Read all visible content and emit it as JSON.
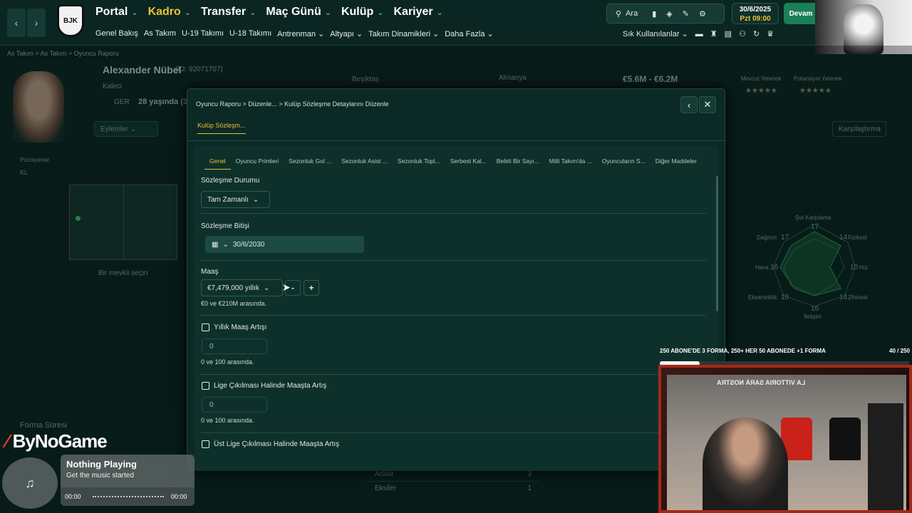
{
  "topbar": {
    "menu": [
      {
        "label": "Portal",
        "active": false
      },
      {
        "label": "Kadro",
        "active": true
      },
      {
        "label": "Transfer",
        "active": false
      },
      {
        "label": "Maç Günü",
        "active": false
      },
      {
        "label": "Kulüp",
        "active": false
      },
      {
        "label": "Kariyer",
        "active": false
      }
    ],
    "submenu": [
      "Genel Bakış",
      "As Takım",
      "U-19 Takımı",
      "U-18 Takımı",
      "Antrenman",
      "Altyapı",
      "Takım Dinamikleri",
      "Daha Fazla"
    ],
    "search_label": "Ara",
    "date": "30/6/2025",
    "day_time": "Pzt  09:00",
    "continue_label": "Devam",
    "quick_label": "Sık Kullanılanlar"
  },
  "background": {
    "breadcrumb": "As Takım  >  As Takım  >  Oyuncu Raporu",
    "player_name": "Alexander Nübel",
    "player_id": "(ID: 92071707)",
    "position": "Kaleci",
    "nation": "GER",
    "age": "28 yaşında (3",
    "club": "Beşiktaş",
    "country": "Almanya",
    "value": "€5.6M - €6.2M",
    "current_ability": "Mevcut Yetenek",
    "potential_ability": "Potansiyel Yetenek",
    "actions": "Eylemler",
    "compare": "Karşılaştırma",
    "positions_label": "Pozisyonlar",
    "positions_value": "KL",
    "choose_position": "Bir mevkii seçin",
    "form_label": "Forma Süresi",
    "list_items": [
      {
        "k": "Artılar",
        "v": "3"
      },
      {
        "k": "Eksiler",
        "v": "1"
      }
    ],
    "radar_labels": {
      "top": "Şut Karşılama",
      "top_val": "17",
      "tl": "Dağıtım",
      "tl_val": "17",
      "tr": "Fiziksel",
      "tr_val": "14",
      "l": "Hava",
      "l_val": "16",
      "r": "Hız",
      "r_val": "10",
      "bl": "Eksantriklik",
      "bl_val": "10",
      "br": "Zihinsel",
      "br_val": "14",
      "bottom": "İletişim",
      "bottom_val": "16"
    }
  },
  "modal": {
    "breadcrumb": "Oyuncu Raporu  >  Düzenle...  >  Kulüp Sözleşme Detaylarını Düzenle",
    "tab": "Kulüp Sözleşm...",
    "inner_tabs": [
      "Genel",
      "Oyuncu Primleri",
      "Sezonluk Gol ...",
      "Sezonluk Asist ...",
      "Sezonluk Topl...",
      "Serbest Kal...",
      "Belirli Bir Sayı...",
      "Milli Takım'da ...",
      "Oyuncuların S...",
      "Diğer Maddeler"
    ],
    "contract_status_label": "Sözleşme Durumu",
    "contract_status_value": "Tam Zamanlı",
    "contract_end_label": "Sözleşme Bitişi",
    "contract_end_value": "30/6/2030",
    "salary_label": "Maaş",
    "salary_value": "€7,479,000 yıllık",
    "salary_hint": "€0 ve €210M arasında.",
    "minus": "-",
    "plus": "+",
    "annual_raise_label": "Yıllık Maaş Artışı",
    "annual_raise_value": "0",
    "annual_raise_hint": "0 ve 100 arasında.",
    "promo_raise_label": "Lige Çıkılması Halinde Maaşta Artış",
    "promo_raise_value": "0",
    "promo_raise_hint": "0 ve 100 arasında.",
    "top_league_label": "Üst Lige Çıkılması Halinde Maaşta Artış"
  },
  "stream": {
    "promo_text": "250 ABONE'DE 3 FORMA, 250+ HER 50 ABONEDE +1 FORMA",
    "promo_count": "40 / 250",
    "progress": 0.16,
    "brand": "ByNoGame",
    "music_title": "Nothing Playing",
    "music_sub": "Get the music started",
    "time_start": "00:00",
    "time_end": "00:00",
    "banner_text": "LA VITTORIA SARÀ NOSTRA"
  }
}
